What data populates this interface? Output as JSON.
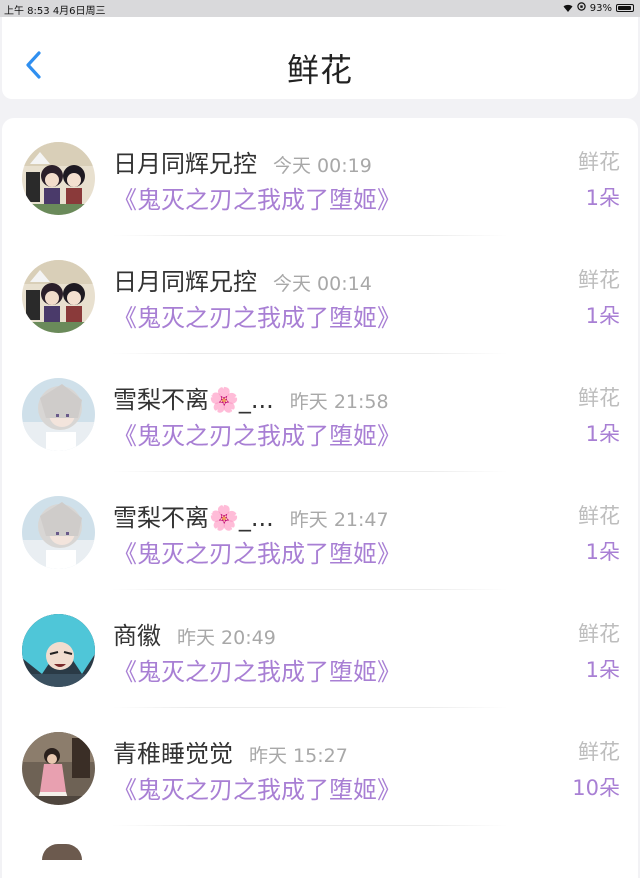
{
  "status_bar": {
    "time_date": "上午 8:53   4月6日周三",
    "battery": "93%"
  },
  "header": {
    "title": "鲜花"
  },
  "rows": [
    {
      "name": "日月同辉兄控",
      "time": "今天 00:19",
      "book": "《鬼灭之刃之我成了堕姬》",
      "gift": "鲜花",
      "count": "1朵"
    },
    {
      "name": "日月同辉兄控",
      "time": "今天 00:14",
      "book": "《鬼灭之刃之我成了堕姬》",
      "gift": "鲜花",
      "count": "1朵"
    },
    {
      "name": "雪梨不离🌸_...",
      "time": "昨天 21:58",
      "book": "《鬼灭之刃之我成了堕姬》",
      "gift": "鲜花",
      "count": "1朵"
    },
    {
      "name": "雪梨不离🌸_...",
      "time": "昨天 21:47",
      "book": "《鬼灭之刃之我成了堕姬》",
      "gift": "鲜花",
      "count": "1朵"
    },
    {
      "name": "商徽",
      "time": "昨天 20:49",
      "book": "《鬼灭之刃之我成了堕姬》",
      "gift": "鲜花",
      "count": "1朵"
    },
    {
      "name": "青稚睡觉觉",
      "time": "昨天 15:27",
      "book": "《鬼灭之刃之我成了堕姬》",
      "gift": "鲜花",
      "count": "10朵"
    }
  ]
}
